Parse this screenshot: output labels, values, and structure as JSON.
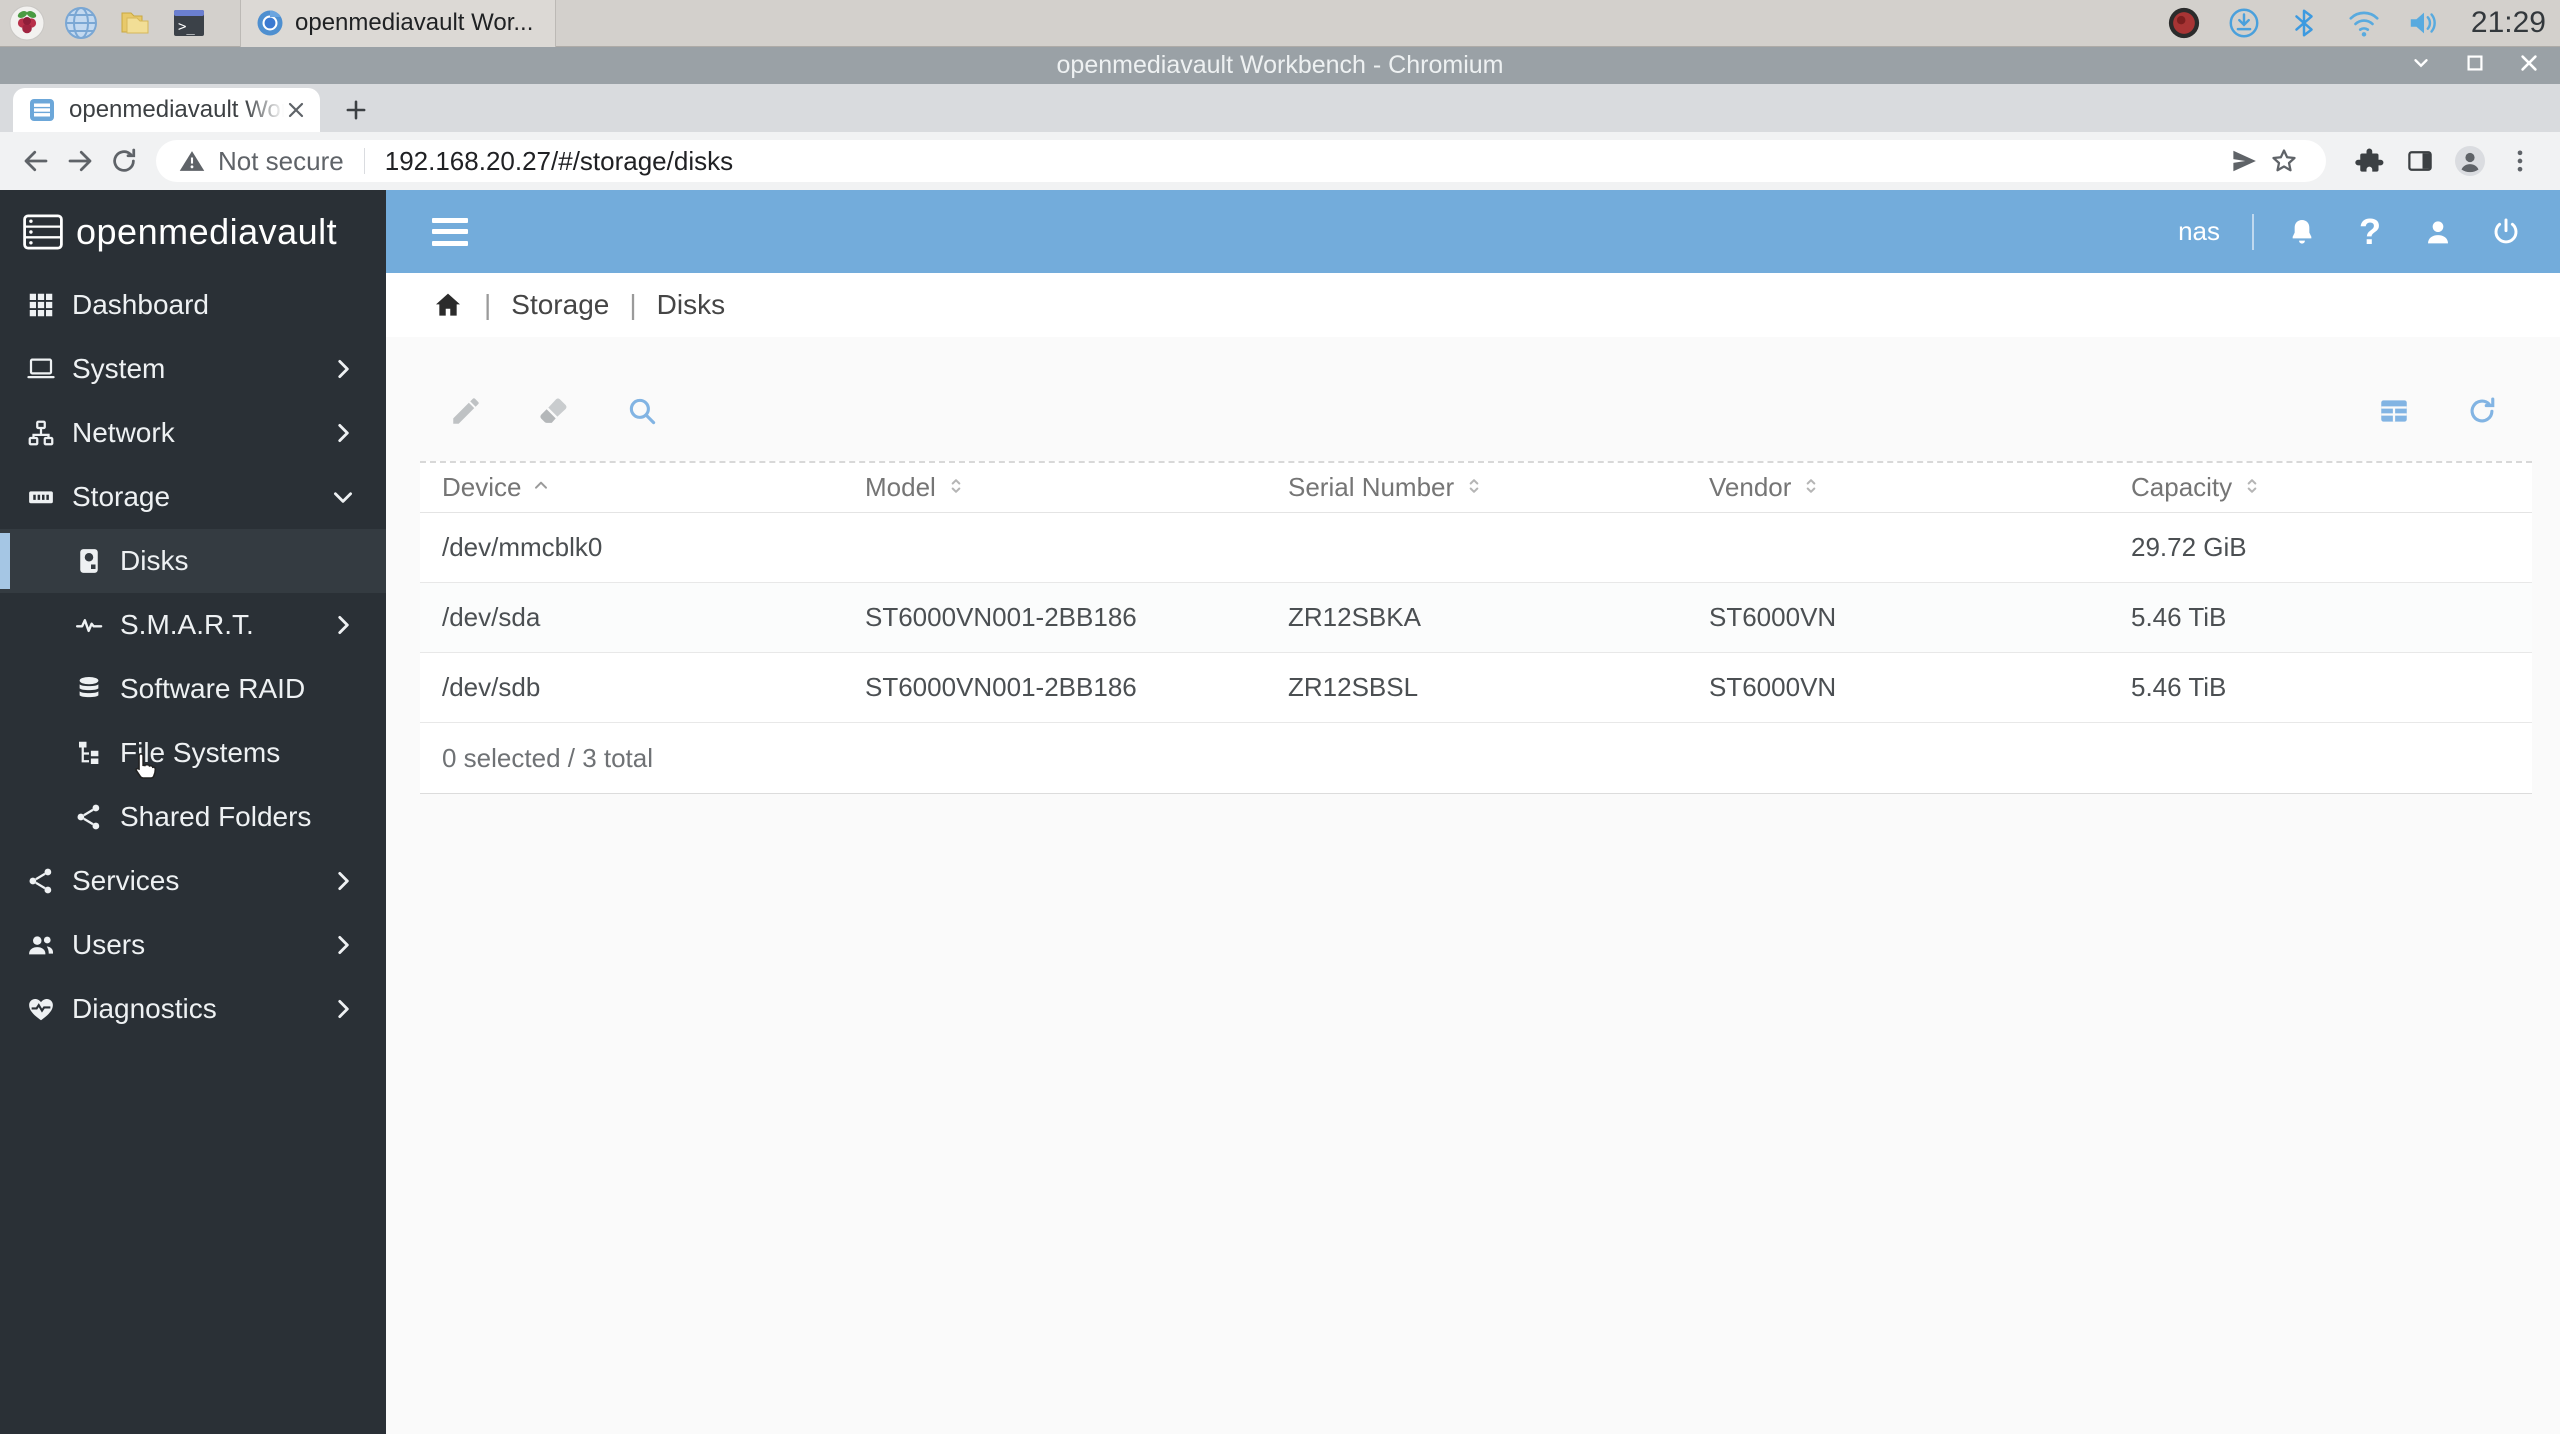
{
  "os_taskbar": {
    "app_window_button": "openmediavault Wor...",
    "clock": "21:29"
  },
  "browser": {
    "window_title": "openmediavault Workbench - Chromium",
    "tab_title": "openmediavault Workbe",
    "security_label": "Not secure",
    "url": "192.168.20.27/#/storage/disks"
  },
  "app": {
    "logo_text": "openmediavault",
    "header": {
      "hostname": "nas"
    },
    "sidebar": {
      "items": [
        {
          "label": "Dashboard"
        },
        {
          "label": "System"
        },
        {
          "label": "Network"
        },
        {
          "label": "Storage"
        },
        {
          "label": "Disks"
        },
        {
          "label": "S.M.A.R.T."
        },
        {
          "label": "Software RAID"
        },
        {
          "label": "File Systems"
        },
        {
          "label": "Shared Folders"
        },
        {
          "label": "Services"
        },
        {
          "label": "Users"
        },
        {
          "label": "Diagnostics"
        }
      ]
    },
    "breadcrumb": {
      "section": "Storage",
      "page": "Disks"
    },
    "table": {
      "columns": [
        {
          "label": "Device",
          "sort": "asc"
        },
        {
          "label": "Model",
          "sort": "none"
        },
        {
          "label": "Serial Number",
          "sort": "none"
        },
        {
          "label": "Vendor",
          "sort": "none"
        },
        {
          "label": "Capacity",
          "sort": "none"
        }
      ],
      "rows": [
        {
          "device": "/dev/mmcblk0",
          "model": "",
          "serial": "",
          "vendor": "",
          "capacity": "29.72 GiB"
        },
        {
          "device": "/dev/sda",
          "model": "ST6000VN001-2BB186",
          "serial": "ZR12SBKA",
          "vendor": "ST6000VN",
          "capacity": "5.46 TiB"
        },
        {
          "device": "/dev/sdb",
          "model": "ST6000VN001-2BB186",
          "serial": "ZR12SBSL",
          "vendor": "ST6000VN",
          "capacity": "5.46 TiB"
        }
      ],
      "footer": "0 selected / 3 total"
    }
  },
  "colors": {
    "header_blue": "#73acdb",
    "sidebar_dark": "#2a3036",
    "accent_blue": "#82b4e3"
  }
}
